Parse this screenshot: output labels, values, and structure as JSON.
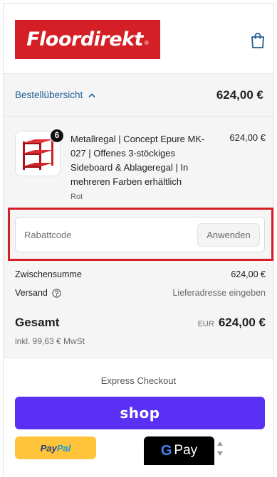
{
  "header": {
    "logo_text": "Floordirekt",
    "logo_reg": "®",
    "cart_icon": "shopping-bag-icon"
  },
  "summary": {
    "toggle_label": "Bestellübersicht",
    "total": "624,00 €"
  },
  "product": {
    "quantity": "6",
    "title": "Metallregal | Concept Epure MK-027 | Offenes 3-stöckiges Sideboard & Ablageregal | In mehreren Farben erhältlich",
    "variant": "Rot",
    "price": "624,00 €"
  },
  "discount": {
    "placeholder": "Rabattcode",
    "apply_label": "Anwenden"
  },
  "totals": {
    "subtotal_label": "Zwischensumme",
    "subtotal_value": "624,00 €",
    "shipping_label": "Versand",
    "shipping_value": "Lieferadresse eingeben",
    "total_label": "Gesamt",
    "currency": "EUR",
    "total_value": "624,00 €",
    "tax_note": "inkl. 99,63 € MwSt"
  },
  "express": {
    "title": "Express Checkout",
    "shop_label": "shop",
    "paypal_part1": "Pay",
    "paypal_part2": "Pal",
    "gpay_g": "G",
    "gpay_label": "Pay"
  },
  "colors": {
    "brand_red": "#d41f26",
    "link_blue": "#1f5d96",
    "shop_purple": "#5a31f4",
    "paypal_yellow": "#ffc439",
    "panel_gray": "#f5f5f5"
  }
}
